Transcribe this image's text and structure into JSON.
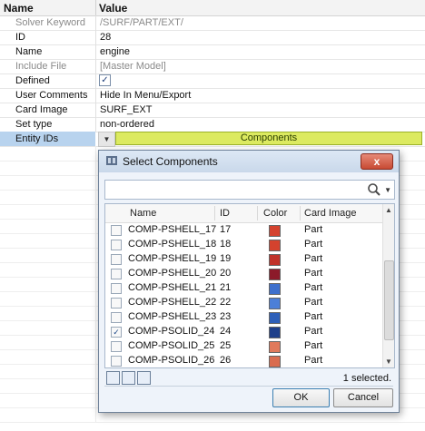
{
  "grid": {
    "headers": {
      "name": "Name",
      "value": "Value"
    },
    "rows": [
      {
        "key": "Solver Keyword",
        "value": "/SURF/PART/EXT/",
        "muted": true
      },
      {
        "key": "ID",
        "value": "28",
        "muted": false
      },
      {
        "key": "Name",
        "value": "engine",
        "muted": false
      },
      {
        "key": "Include File",
        "value": "[Master Model]",
        "muted": true
      },
      {
        "key": "Defined",
        "value": "",
        "checkbox": true,
        "checked": true
      },
      {
        "key": "User Comments",
        "value": "Hide In Menu/Export",
        "muted": false
      },
      {
        "key": "Card Image",
        "value": "SURF_EXT",
        "muted": false
      },
      {
        "key": "Set type",
        "value": "non-ordered",
        "muted": false
      }
    ],
    "entity_row": {
      "key": "Entity IDs",
      "button_label": "Components"
    }
  },
  "dialog": {
    "title": "Select Components",
    "search_value": "",
    "columns": {
      "name": "Name",
      "id": "ID",
      "color": "Color",
      "card_image": "Card Image"
    },
    "rows": [
      {
        "name": "COMP-PSHELL_17",
        "id": "17",
        "color": "#d4422e",
        "card": "Part",
        "checked": false
      },
      {
        "name": "COMP-PSHELL_18",
        "id": "18",
        "color": "#d4422e",
        "card": "Part",
        "checked": false
      },
      {
        "name": "COMP-PSHELL_19",
        "id": "19",
        "color": "#c0332a",
        "card": "Part",
        "checked": false
      },
      {
        "name": "COMP-PSHELL_20",
        "id": "20",
        "color": "#8c1a2a",
        "card": "Part",
        "checked": false
      },
      {
        "name": "COMP-PSHELL_21",
        "id": "21",
        "color": "#3d6fcc",
        "card": "Part",
        "checked": false
      },
      {
        "name": "COMP-PSHELL_22",
        "id": "22",
        "color": "#4c7fd8",
        "card": "Part",
        "checked": false
      },
      {
        "name": "COMP-PSHELL_23",
        "id": "23",
        "color": "#2e5fb8",
        "card": "Part",
        "checked": false
      },
      {
        "name": "COMP-PSOLID_24",
        "id": "24",
        "color": "#1e3f8a",
        "card": "Part",
        "checked": true
      },
      {
        "name": "COMP-PSOLID_25",
        "id": "25",
        "color": "#e07a5c",
        "card": "Part",
        "checked": false
      },
      {
        "name": "COMP-PSOLID_26",
        "id": "26",
        "color": "#d96c50",
        "card": "Part",
        "checked": false
      }
    ],
    "selected_count": "1 selected.",
    "ok_label": "OK",
    "cancel_label": "Cancel",
    "close_label": "x"
  }
}
